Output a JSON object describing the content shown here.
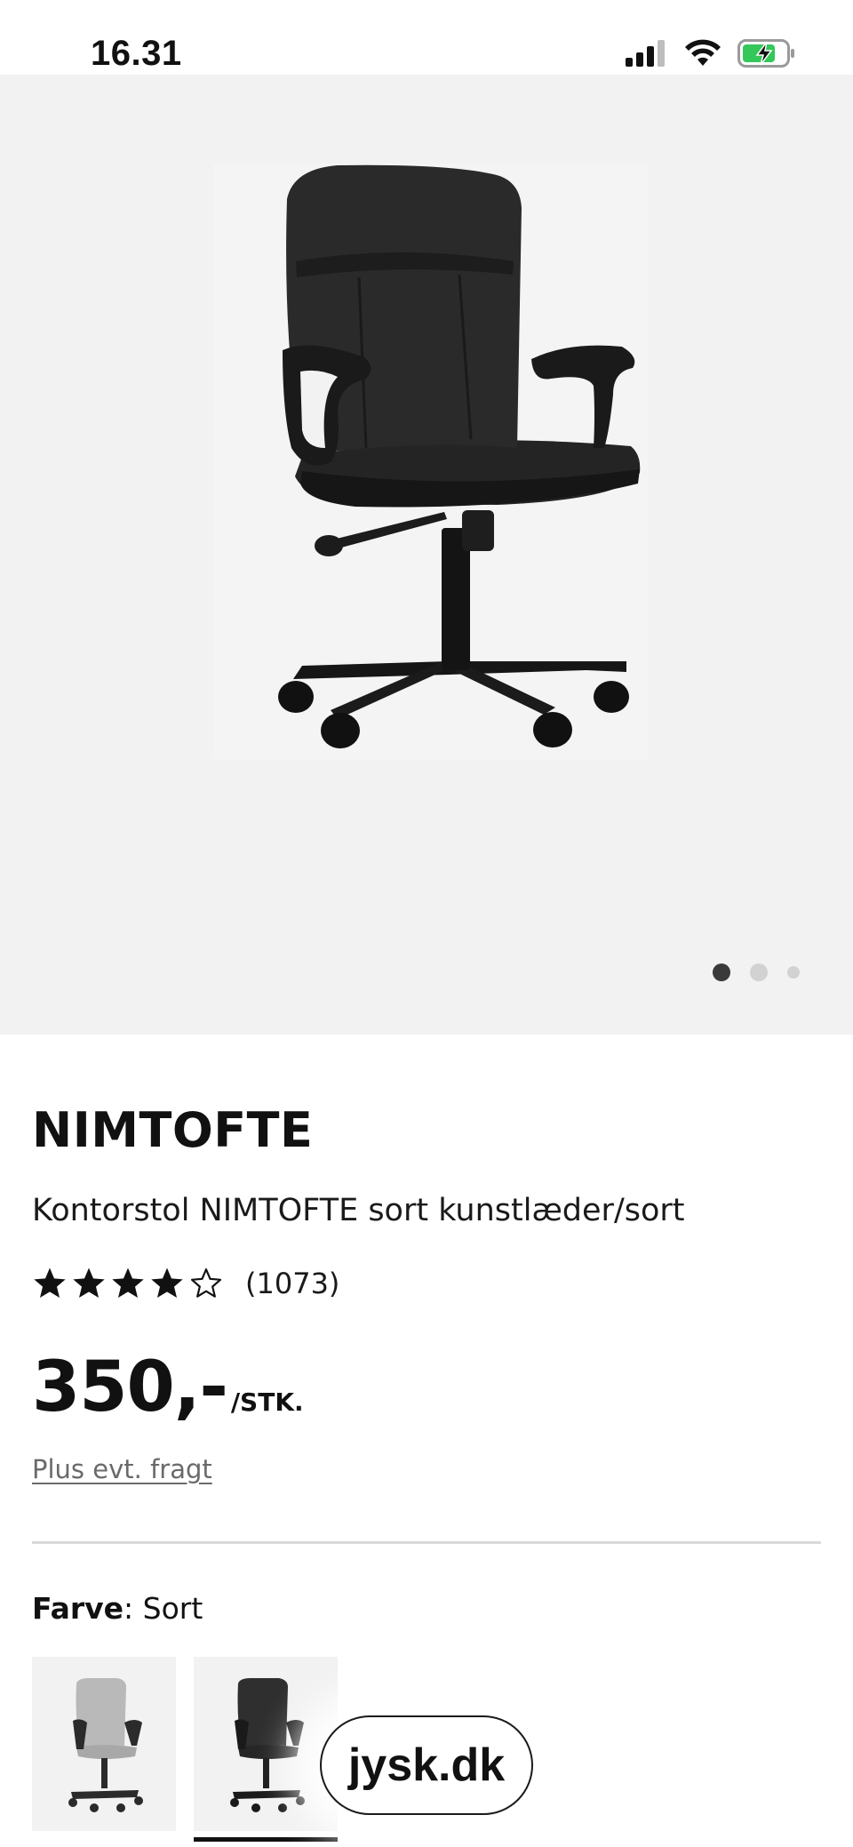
{
  "status_bar": {
    "time": "16.31",
    "icons": [
      "cellular-signal-icon",
      "wifi-icon",
      "battery-charging-icon"
    ],
    "battery_color": "#34c759"
  },
  "gallery": {
    "image": "black-office-chair-photo",
    "page_count": 3,
    "active_index": 0
  },
  "product": {
    "name": "NIMTOFTE",
    "description": "Kontorstol NIMTOFTE sort kunstlæder/sort",
    "rating": 4,
    "rating_max": 5,
    "review_count": "(1073)",
    "price": "350,-",
    "unit": "/STK.",
    "freight_link": "Plus evt. fragt"
  },
  "color_selector": {
    "label": "Farve",
    "separator": ": ",
    "value": "Sort",
    "options": [
      {
        "name": "grey-chair-swatch",
        "color": "#b9b9b9",
        "selected": false
      },
      {
        "name": "black-chair-swatch",
        "color": "#2b2b2b",
        "selected": true
      }
    ]
  },
  "browser": {
    "site": "jysk.dk"
  }
}
